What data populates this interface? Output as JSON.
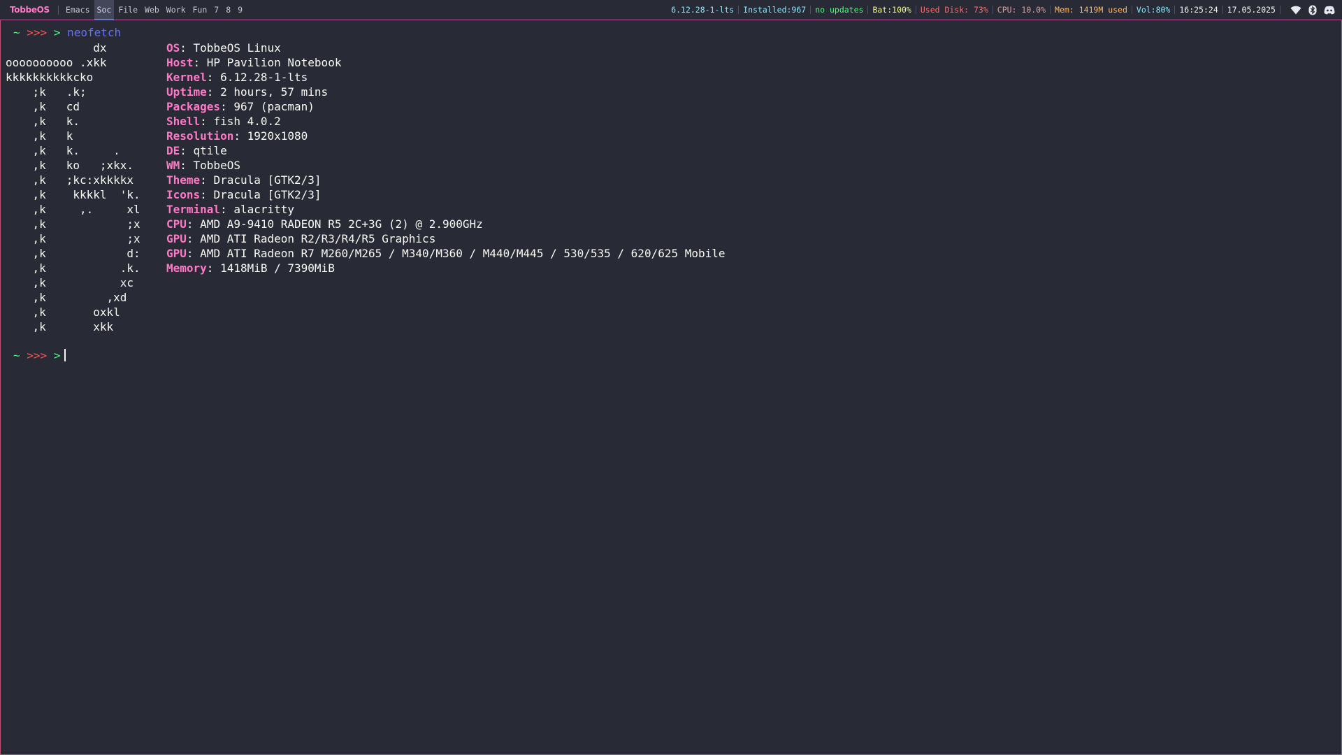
{
  "bar": {
    "logo": "TobbeOS",
    "workspaces": [
      "Emacs",
      "Soc",
      "File",
      "Web",
      "Work",
      "Fun",
      "7",
      "8",
      "9"
    ],
    "active_workspace": "Soc",
    "widgets": {
      "kernel": "6.12.28-1-lts",
      "installed": "Installed:967",
      "updates": "no updates",
      "battery": "Bat:100%",
      "disk": "Used Disk: 73%",
      "cpu": "CPU: 10.0%",
      "memory": "Mem: 1419M used",
      "volume": "Vol:80%",
      "time": "16:25:24",
      "date": "17.05.2025"
    },
    "tray_icons": [
      "wifi-icon",
      "bluetooth-icon",
      "discord-icon"
    ]
  },
  "terminal": {
    "prompt": {
      "tilde": "~",
      "arrows": ">>>",
      "gt": ">"
    },
    "command": "neofetch",
    "ascii_art": [
      "             dx",
      "oooooooooo .xkk",
      "kkkkkkkkkkcko",
      "    ;k   .k;",
      "    ,k   cd",
      "    ,k   k.",
      "    ,k   k",
      "    ,k   k.     .",
      "    ,k   ko   ;xkx.",
      "    ,k   ;kc:xkkkkx",
      "    ,k    kkkkl  'k.",
      "    ,k     ,.     xl",
      "    ,k            ;x",
      "    ,k            ;x",
      "    ,k            d:",
      "    ,k           .k.",
      "    ,k           xc",
      "    ,k         ,xd",
      "    ,k       oxkl",
      "    ,k       xkk"
    ],
    "info": [
      {
        "key": "OS",
        "value": "TobbeOS Linux"
      },
      {
        "key": "Host",
        "value": "HP Pavilion Notebook"
      },
      {
        "key": "Kernel",
        "value": "6.12.28-1-lts"
      },
      {
        "key": "Uptime",
        "value": "2 hours, 57 mins"
      },
      {
        "key": "Packages",
        "value": "967 (pacman)"
      },
      {
        "key": "Shell",
        "value": "fish 4.0.2"
      },
      {
        "key": "Resolution",
        "value": "1920x1080"
      },
      {
        "key": "DE",
        "value": "qtile"
      },
      {
        "key": "WM",
        "value": "TobbeOS"
      },
      {
        "key": "Theme",
        "value": "Dracula [GTK2/3]"
      },
      {
        "key": "Icons",
        "value": "Dracula [GTK2/3]"
      },
      {
        "key": "Terminal",
        "value": "alacritty"
      },
      {
        "key": "CPU",
        "value": "AMD A9-9410 RADEON R5 2C+3G (2) @ 2.900GHz"
      },
      {
        "key": "GPU",
        "value": "AMD ATI Radeon R2/R3/R4/R5 Graphics"
      },
      {
        "key": "GPU",
        "value": "AMD ATI Radeon R7 M260/M265 / M340/M360 / M440/M445 / 530/535 / 620/625 Mobile"
      },
      {
        "key": "Memory",
        "value": "1418MiB / 7390MiB"
      }
    ]
  }
}
